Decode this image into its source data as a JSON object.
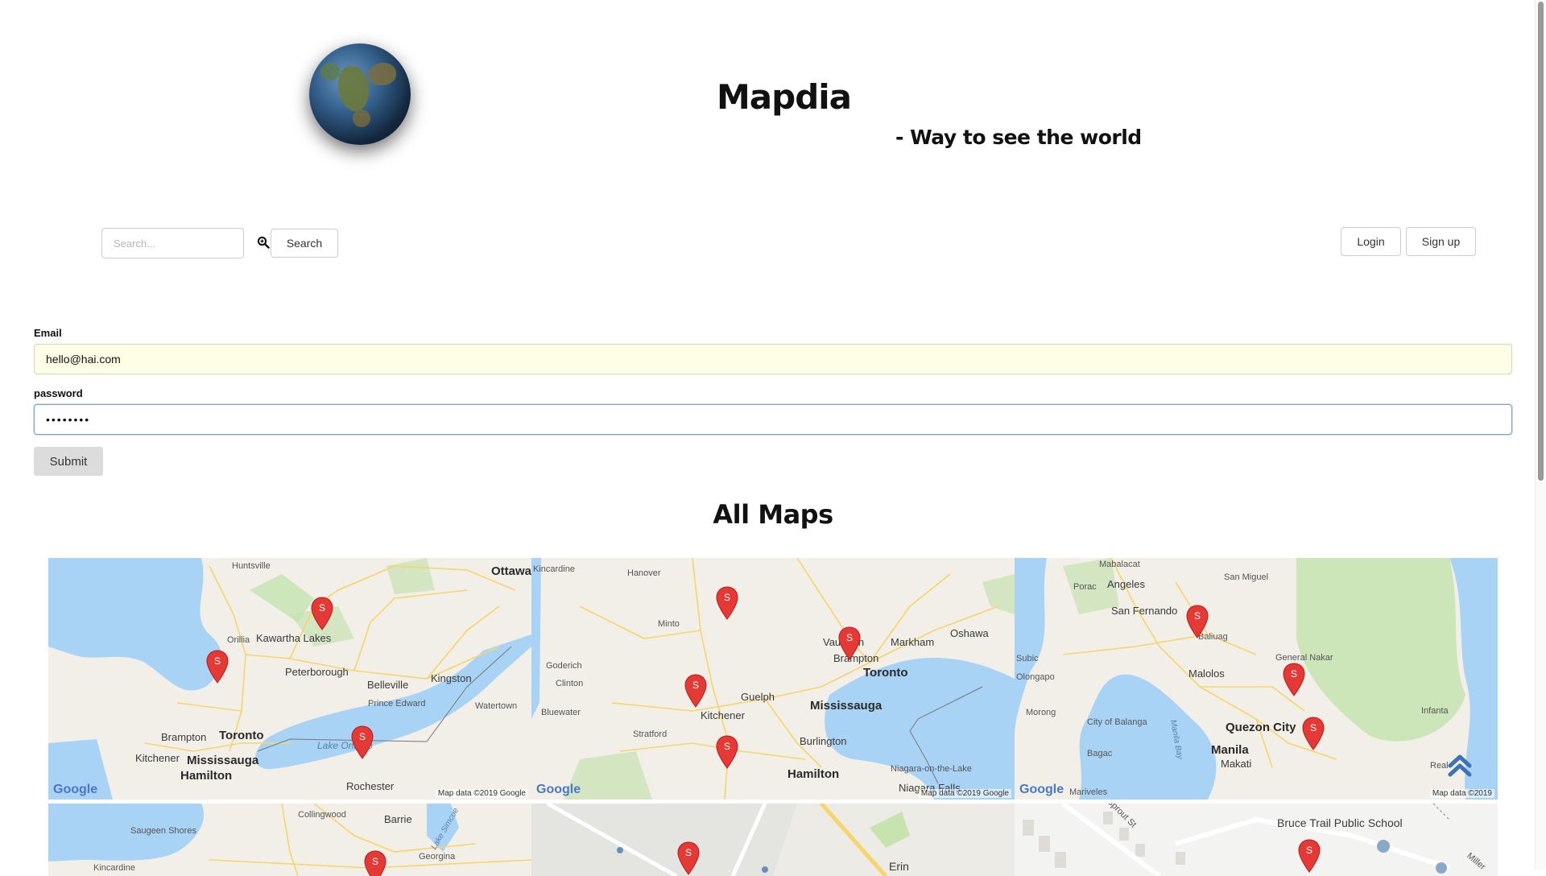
{
  "header": {
    "title": "Mapdia",
    "tagline": "- Way to see the world"
  },
  "search": {
    "placeholder": "Search...",
    "button_label": "Search"
  },
  "auth": {
    "login_label": "Login",
    "signup_label": "Sign up"
  },
  "form": {
    "email_label": "Email",
    "email_value": "hello@hai.com",
    "password_label": "password",
    "password_value": "••••••••",
    "submit_label": "Submit"
  },
  "maps_section": {
    "title": "All Maps",
    "pin_label": "S",
    "google_logo": "Google",
    "credit_full": "Map data ©2019 Google",
    "credit_short": "Map data ©2019",
    "map1": {
      "places": [
        "Huntsville",
        "Ottawa",
        "Kawartha Lakes",
        "Orillia",
        "Peterborough",
        "Belleville",
        "Kingston",
        "Prince Edward",
        "Watertown",
        "Brampton",
        "Toronto",
        "Kitchener",
        "Mississauga",
        "Hamilton",
        "Lake Ontario",
        "Rochester"
      ]
    },
    "map2": {
      "places": [
        "Kincardine",
        "Hanover",
        "Minto",
        "Goderich",
        "Clinton",
        "Bluewater",
        "Stratford",
        "Guelph",
        "Kitchener",
        "Brampton",
        "Vaughan",
        "Markham",
        "Oshawa",
        "Toronto",
        "Mississauga",
        "Burlington",
        "Hamilton",
        "Niagara-on-the-Lake",
        "Niagara Falls"
      ]
    },
    "map3": {
      "places": [
        "Mabalacat",
        "Angeles",
        "Porac",
        "San Miguel",
        "San Fernando",
        "Baliuag",
        "Subic",
        "Olongapo",
        "Malolos",
        "General Nakar",
        "Morong",
        "City of Balanga",
        "Bagac",
        "Quezon City",
        "Manila",
        "Makati",
        "Infanta",
        "Real",
        "Mariveles",
        "Manila Bay"
      ]
    },
    "map4": {
      "places": [
        "Collingwood",
        "Barrie",
        "Saugeen Shores",
        "Georgina",
        "Kincardine",
        "Lake Simcoe"
      ]
    },
    "map5": {
      "places": [
        "Erin"
      ]
    },
    "map6": {
      "places": [
        "Bruce Trail Public School",
        "Sprout St",
        "Miller"
      ]
    }
  },
  "colors": {
    "water": "#a9d3f5",
    "land": "#f1efe8",
    "green": "#c6e3b0",
    "road": "#f7d56a",
    "pin": "#e53935"
  }
}
